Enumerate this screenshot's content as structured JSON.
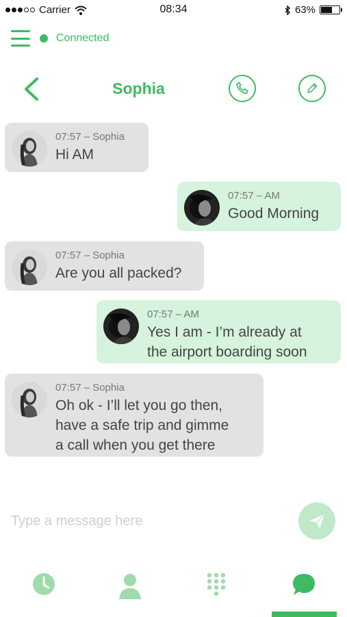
{
  "status_bar": {
    "carrier": "Carrier",
    "time": "08:34",
    "battery": "63%",
    "battery_level": 0.63
  },
  "connection": {
    "status": "Connected"
  },
  "header": {
    "title": "Sophia",
    "icons": [
      "back-icon",
      "phone-icon",
      "pencil-icon"
    ]
  },
  "messages": [
    {
      "direction": "in",
      "meta": "07:57 – Sophia",
      "text": "Hi AM"
    },
    {
      "direction": "out",
      "meta": "07:57 – AM",
      "text": "Good Morning"
    },
    {
      "direction": "in",
      "meta": "07:57 – Sophia",
      "text": "Are you all packed?"
    },
    {
      "direction": "out",
      "meta": "07:57 – AM",
      "text": "Yes I am - I’m already at\nthe airport boarding soon"
    },
    {
      "direction": "in",
      "meta": "07:57 – Sophia",
      "text": "Oh ok - I’ll let you go then,\nhave a safe trip and gimme\na call when you get there"
    }
  ],
  "composer": {
    "placeholder": "Type a message here",
    "value": ""
  },
  "nav": {
    "items": [
      "clock-icon",
      "contact-icon",
      "dialpad-icon",
      "chat-icon"
    ],
    "active": "chat-icon"
  },
  "colors": {
    "accent": "#3dbb61",
    "incoming_bubble": "#e2e2e2",
    "outgoing_bubble": "#d6f3dd"
  }
}
